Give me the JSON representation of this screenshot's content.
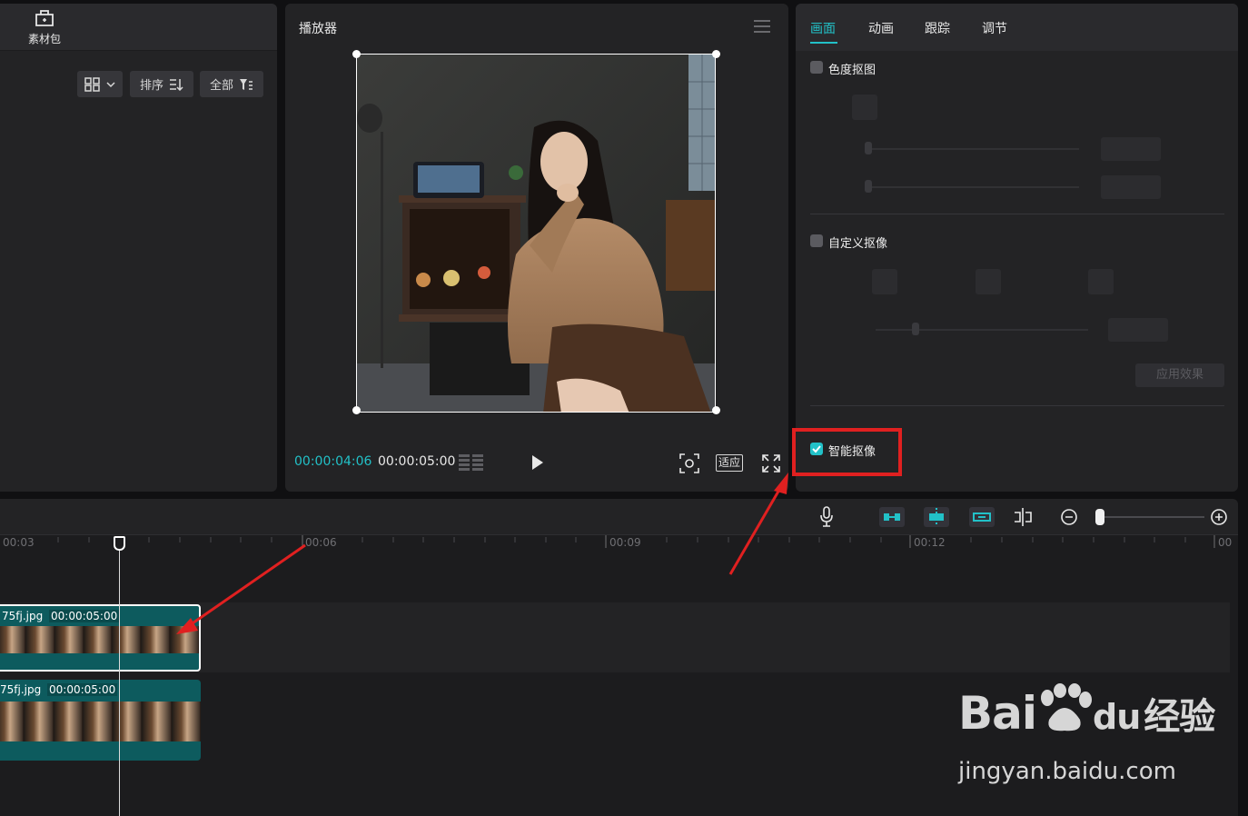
{
  "left_panel": {
    "material_tab_label": "素材包",
    "sort_label": "排序",
    "filter_label": "全部"
  },
  "player": {
    "title": "播放器",
    "current_time": "00:00:04:06",
    "total_time": "00:00:05:00",
    "fit_label": "适应"
  },
  "properties": {
    "tabs": [
      {
        "label": "画面",
        "active": true
      },
      {
        "label": "动画",
        "active": false
      },
      {
        "label": "跟踪",
        "active": false
      },
      {
        "label": "调节",
        "active": false
      }
    ],
    "chroma_key_label": "色度抠图",
    "custom_cutout_label": "自定义抠像",
    "apply_effect_label": "应用效果",
    "smart_cutout_label": "智能抠像",
    "smart_cutout_checked": true
  },
  "timeline": {
    "ruler_labels": [
      "00:03",
      "00:06",
      "00:09",
      "00:12",
      "00"
    ],
    "tracks": [
      {
        "clip_name": "75fj.jpg",
        "clip_duration": "00:00:05:00",
        "selected": true
      },
      {
        "clip_name": "75fj.jpg",
        "clip_duration": "00:00:05:00",
        "selected": false
      }
    ]
  },
  "watermark": {
    "logo_text": "Bai",
    "logo_text_2": "du",
    "logo_cn": "经验",
    "url": "jingyan.baidu.com"
  },
  "colors": {
    "accent": "#22c1c8",
    "annotation_red": "#e02020",
    "clip_teal": "#0d5b5e"
  }
}
